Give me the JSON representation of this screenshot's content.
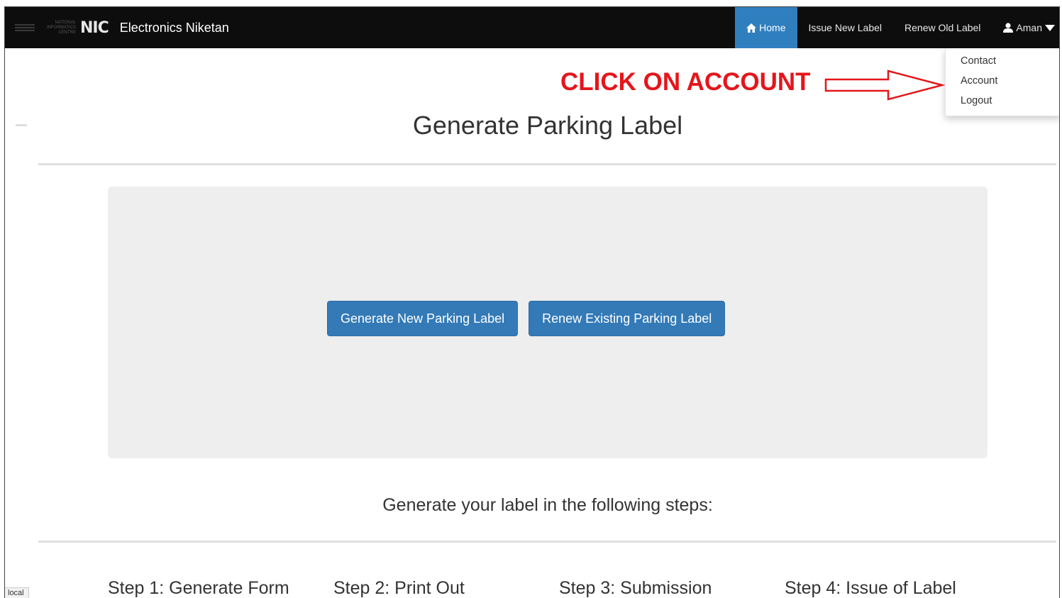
{
  "navbar": {
    "org_small": [
      "NATIONAL",
      "INFORMATICS",
      "CENTRE"
    ],
    "logo_text": "NIC",
    "brand_title": "Electronics Niketan",
    "items": [
      {
        "label": "Home",
        "active": true,
        "icon": "home-icon"
      },
      {
        "label": "Issue New Label",
        "active": false
      },
      {
        "label": "Renew Old Label",
        "active": false
      }
    ],
    "user": {
      "label": "Aman",
      "icon": "user-icon",
      "caret": "caret-down-icon"
    }
  },
  "dropdown": {
    "items": [
      "Contact",
      "Account",
      "Logout"
    ]
  },
  "annotation": {
    "text": "CLICK ON ACCOUNT",
    "color": "#e4161b"
  },
  "main": {
    "title": "Generate Parking Label",
    "buttons": {
      "generate_new": "Generate New Parking Label",
      "renew_existing": "Renew Existing Parking Label"
    },
    "steps_heading": "Generate your label in the following steps:",
    "steps": [
      "Step 1: Generate Form",
      "Step 2: Print Out",
      "Step 3: Submission",
      "Step 4: Issue of Label"
    ]
  },
  "status": {
    "local_label": "local"
  },
  "colors": {
    "navbar_bg": "#0d0d0d",
    "active_nav": "#2f7fbf",
    "primary_button": "#337ab7",
    "jumbotron_bg": "#eeeeee"
  }
}
